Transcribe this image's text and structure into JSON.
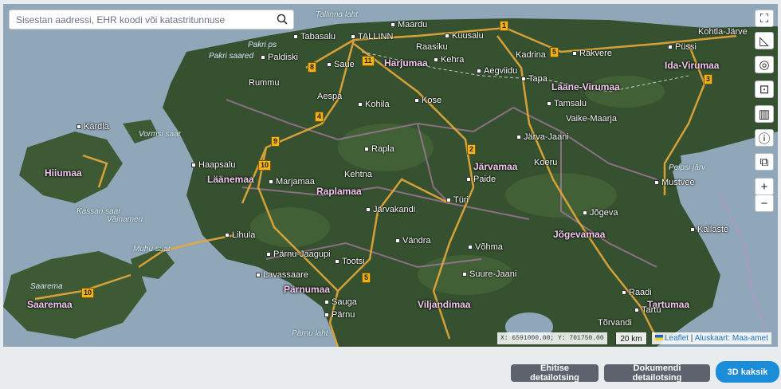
{
  "search": {
    "placeholder": "Sisestan aadressi, EHR koodi või katastritunnuse"
  },
  "map": {
    "counties": [
      "Harjumaa",
      "Lääne-Virumaa",
      "Ida-Virumaa",
      "Hiiumaa",
      "Läänemaa",
      "Raplamaa",
      "Järvamaa",
      "Jõgevamaa",
      "Saaremaa",
      "Pärnumaa",
      "Viljandimaa",
      "Tartumaa"
    ],
    "towns": [
      "Tallinna laht",
      "Maardu",
      "TALLINN",
      "Tabasalu",
      "Kuusalu",
      "Pakri ps",
      "Paldiski",
      "Pakri saared",
      "Saue",
      "Raasiku",
      "Kehra",
      "Rummu",
      "Aegviidu",
      "Kadrina",
      "Rakvere",
      "Kohtla-Järve",
      "Püssi",
      "Tapa",
      "Aespa",
      "Kohila",
      "Kose",
      "Tamsalu",
      "Vaike-Maarja",
      "Järva-Jaani",
      "Kärdla",
      "Haapsalu",
      "Rapla",
      "Koeru",
      "Peipsi järv",
      "Kehtna",
      "Paide",
      "Mustvee",
      "Marjamaa",
      "Türi",
      "Järvakandi",
      "Jõgeva",
      "Kassari saar",
      "Väinameri",
      "Vormsi saar",
      "Kallaste",
      "Lihula",
      "Vändra",
      "Muhu saar",
      "Võhma",
      "Pärnu-Jaagupi",
      "Tootsi",
      "Suure-Jaani",
      "Lavassaare",
      "Saarema",
      "Sauga",
      "Pärnu",
      "Raadi",
      "Tartu",
      "Pärnu laht",
      "Tõrvandi"
    ],
    "roads": [
      "1",
      "11",
      "8",
      "5",
      "3",
      "4",
      "9",
      "2",
      "10",
      "10",
      "5"
    ],
    "coords": "X: 6591000.00; Y: 701750.00",
    "scale": "20 km",
    "attribution": {
      "leaflet": "Leaflet",
      "separator": " | ",
      "basemap": "Aluskaart: Maa-amet"
    }
  },
  "controls": {
    "fullscreen": "⛶",
    "measure": "◺",
    "locate": "◎",
    "screenshot": "⊡",
    "layers": "▥",
    "info": "ⓘ",
    "extent": "⧉",
    "zoom_in": "+",
    "zoom_out": "−"
  },
  "buttons": {
    "building_search": "Ehitise detailotsing",
    "document_search": "Dokumendi detailotsing",
    "view_3d": "3D kaksik"
  }
}
